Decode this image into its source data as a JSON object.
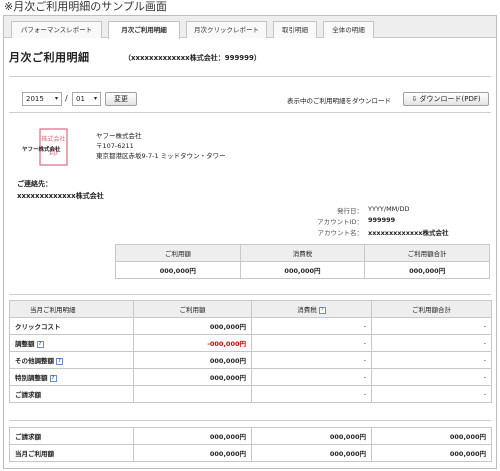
{
  "caption": "※月次ご利用明細のサンプル画面",
  "tabs": [
    {
      "label": "パフォーマンスレポート"
    },
    {
      "label": "月次ご利用明細"
    },
    {
      "label": "月次クリックレポート"
    },
    {
      "label": "取引明細"
    },
    {
      "label": "全体の明細"
    }
  ],
  "header": {
    "title": "月次ご利用明細",
    "company": "（xxxxxxxxxxxxx株式会社：999999）"
  },
  "period": {
    "year": "2015",
    "separator": "/",
    "month": "01",
    "change_label": "変更"
  },
  "download": {
    "description": "表示中のご利用明細をダウンロード",
    "button_label": "ダウンロード(PDF)"
  },
  "issuer": {
    "logo_text": "ヤフー株式会社",
    "seal_text": "株式会社",
    "name": "ヤフー株式会社",
    "postal": "〒107-6211",
    "address": "東京都港区赤坂9-7-1 ミッドタウン・タワー"
  },
  "recipient": {
    "label": "ご連絡先：",
    "name": "xxxxxxxxxxxxx株式会社"
  },
  "meta": [
    {
      "key": "発行日：",
      "value": "YYYY/MM/DD"
    },
    {
      "key": "アカウントID：",
      "value": "999999"
    },
    {
      "key": "アカウント名：",
      "value": "xxxxxxxxxxxxx株式会社"
    }
  ],
  "summary": {
    "headers": [
      "ご利用額",
      "消費税",
      "ご利用額合計"
    ],
    "values": [
      "000,000円",
      "000,000円",
      "000,000円"
    ]
  },
  "detail": {
    "headers": [
      "当月ご利用明細",
      "ご利用額",
      "消費税",
      "ご利用額合計"
    ],
    "help_mark": "?",
    "rows": [
      {
        "label": "クリックコスト",
        "amount": "000,000円",
        "tax": "-",
        "total": "-"
      },
      {
        "label": "調整額",
        "amount": "-000,000円",
        "tax": "-",
        "total": "-"
      },
      {
        "label": "その他調整額",
        "amount": "000,000円",
        "tax": "-",
        "total": "-"
      },
      {
        "label": "特別調整額",
        "amount": "000,000円",
        "tax": "-",
        "total": "-"
      },
      {
        "label": "ご請求額",
        "amount": "",
        "tax": "-",
        "total": "-"
      }
    ]
  },
  "totals": {
    "rows": [
      {
        "label": "ご請求額",
        "amount": "000,000円",
        "tax": "000,000円",
        "total": "000,000円"
      },
      {
        "label": "当月ご利用額",
        "amount": "000,000円",
        "tax": "000,000円",
        "total": "000,000円"
      }
    ]
  },
  "colors": {
    "negative": "#d40000",
    "seal": "#e06a80",
    "header_bg": "#eeeeee"
  }
}
